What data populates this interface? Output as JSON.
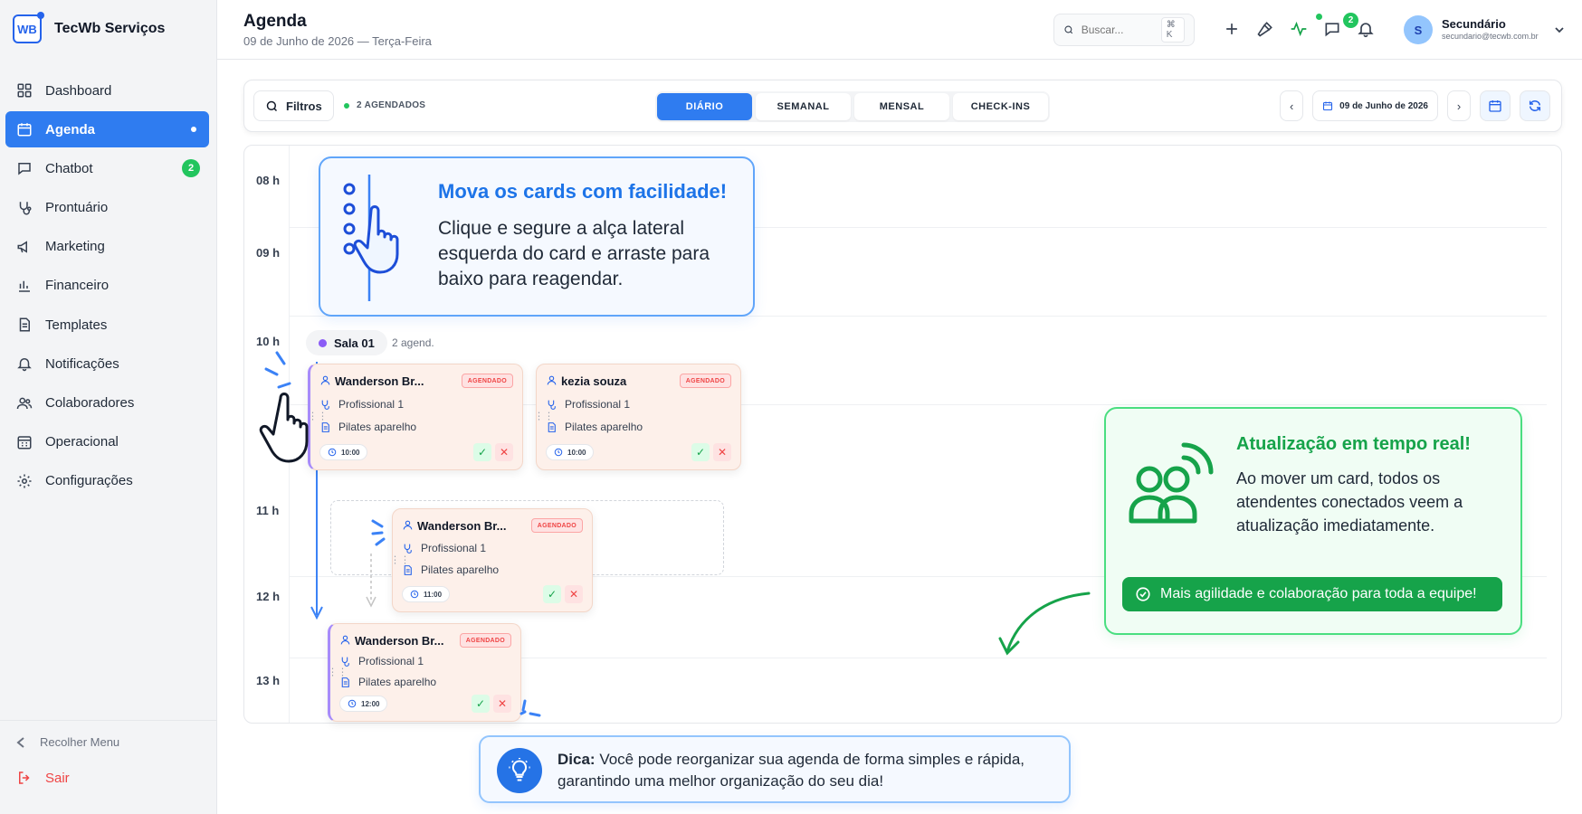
{
  "brand": {
    "name": "TecWb Serviços",
    "logo_text": "WB"
  },
  "sidebar": {
    "items": [
      {
        "label": "Dashboard"
      },
      {
        "label": "Agenda"
      },
      {
        "label": "Chatbot",
        "badge": "2"
      },
      {
        "label": "Prontuário"
      },
      {
        "label": "Marketing"
      },
      {
        "label": "Financeiro"
      },
      {
        "label": "Templates"
      },
      {
        "label": "Notificações"
      },
      {
        "label": "Colaboradores"
      },
      {
        "label": "Operacional"
      },
      {
        "label": "Configurações"
      }
    ],
    "collapse_label": "Recolher Menu",
    "logout_label": "Sair"
  },
  "header": {
    "title": "Agenda",
    "subtitle": "09 de Junho de 2026 — Terça-Feira",
    "search_placeholder": "Buscar...",
    "search_shortcut": "⌘ K",
    "messages_badge": "2",
    "user": {
      "initial": "S",
      "name": "Secundário",
      "email": "secundario@tecwb.com.br"
    }
  },
  "toolbar": {
    "filter_label": "Filtros",
    "scheduled_count": "2 AGENDADOS",
    "tabs": [
      "DIÁRIO",
      "SEMANAL",
      "MENSAL",
      "CHECK-INS"
    ],
    "active_tab": "DIÁRIO",
    "prev_arrow": "‹",
    "next_arrow": "›",
    "date_label": "09 de Junho de 2026"
  },
  "calendar": {
    "hours": [
      "08 h",
      "09 h",
      "10 h",
      "11 h",
      "12 h",
      "13 h"
    ],
    "room": {
      "name": "Sala 01",
      "count": "2 agend."
    },
    "cards": [
      {
        "name": "Wanderson Br...",
        "status": "AGENDADO",
        "professional": "Profissional 1",
        "service": "Pilates aparelho",
        "time": "10:00"
      },
      {
        "name": "kezia souza",
        "status": "AGENDADO",
        "professional": "Profissional 1",
        "service": "Pilates aparelho",
        "time": "10:00"
      },
      {
        "name": "Wanderson Br...",
        "status": "AGENDADO",
        "professional": "Profissional 1",
        "service": "Pilates aparelho",
        "time": "11:00"
      },
      {
        "name": "Wanderson Br...",
        "status": "AGENDADO",
        "professional": "Profissional 1",
        "service": "Pilates aparelho",
        "time": "12:00"
      }
    ],
    "confirm_glyph": "✓",
    "cancel_glyph": "✕"
  },
  "tips": {
    "drag": {
      "title": "Mova os cards com facilidade!",
      "body": "Clique e segure a alça lateral esquerda do card e arraste para baixo para reagendar."
    },
    "realtime": {
      "title": "Atualização em tempo real!",
      "body": "Ao mover um card, todos os atendentes conectados veem a atualização imediatamente.",
      "button": "Mais agilidade e colaboração para toda a equipe!"
    },
    "hint": {
      "label": "Dica:",
      "text": "Você pode reorganizar sua agenda de forma simples e rápida, garantindo uma melhor organização do seu dia!"
    }
  },
  "colors": {
    "primary": "#2f7cf0",
    "success": "#16a34a",
    "danger": "#ef4444",
    "card_bg": "#fdf0ea",
    "room_dot": "#8b5cf6"
  }
}
